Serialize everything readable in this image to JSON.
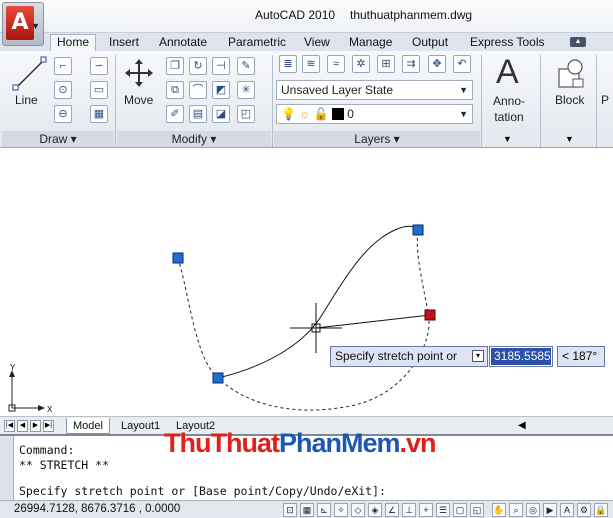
{
  "titlebar": {
    "app": "AutoCAD 2010",
    "file": "thuthuatphanmem.dwg",
    "logo_letter": "A"
  },
  "tabs": [
    {
      "label": "Home",
      "active": true
    },
    {
      "label": "Insert"
    },
    {
      "label": "Annotate"
    },
    {
      "label": "Parametric"
    },
    {
      "label": "View"
    },
    {
      "label": "Manage"
    },
    {
      "label": "Output"
    },
    {
      "label": "Express Tools"
    }
  ],
  "ribbon": {
    "draw": {
      "title": "Draw",
      "line_label": "Line"
    },
    "modify": {
      "title": "Modify",
      "move_label": "Move"
    },
    "layers": {
      "title": "Layers",
      "layer_state": "Unsaved Layer State",
      "current_layer": "0"
    },
    "annotation_label": "Anno-\ntation",
    "block_label": "Block"
  },
  "layout_tabs": [
    {
      "label": "Model",
      "active": true
    },
    {
      "label": "Layout1"
    },
    {
      "label": "Layout2"
    }
  ],
  "ucs": {
    "x": "X",
    "y": "Y"
  },
  "command": {
    "line1": "Command:",
    "line2": "** STRETCH **",
    "prompt": "Specify stretch point or [Base point/Copy/Undo/eXit]:"
  },
  "watermark": {
    "a": "Thu",
    "b": "Thuat",
    "c": "Phan",
    "d": "Mem",
    "e": ".vn"
  },
  "dynamic_input": {
    "prompt": "Specify stretch point or",
    "value": "3185.5585",
    "angle": "< 187°"
  },
  "status": {
    "coords": "26994.7128, 8676.3716 , 0.0000"
  },
  "colors": {
    "grip": "#1f6fd1",
    "hot_grip": "#c0141c",
    "accent": "#2c4fa8"
  }
}
